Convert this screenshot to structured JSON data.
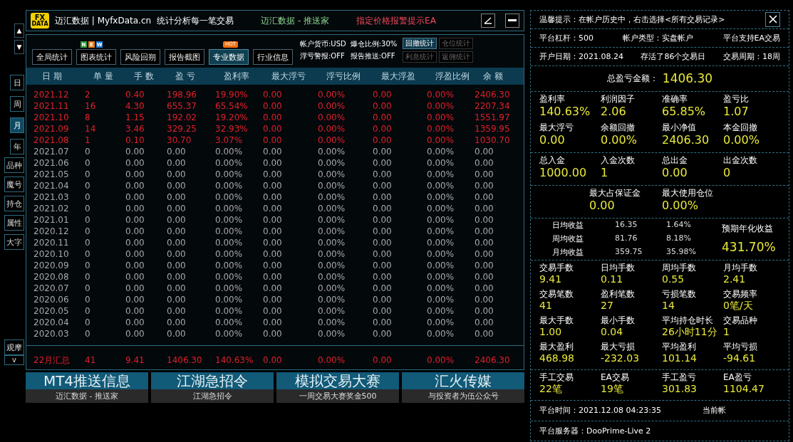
{
  "side_nav": {
    "scroll_up": "▲",
    "scroll_down": "▼",
    "periods": [
      {
        "label": "日",
        "selected": false
      },
      {
        "label": "周",
        "selected": false
      },
      {
        "label": "月",
        "selected": true
      },
      {
        "label": "年",
        "selected": false
      }
    ],
    "filters": [
      "品种",
      "魔号",
      "持仓",
      "属性",
      "大字"
    ],
    "watch": "观摩",
    "expand": "v"
  },
  "title_bar": {
    "logo_top": "FX",
    "logo_bottom": "DATA",
    "title": "迈汇数据 | MyfxData.cn",
    "slogan": "统计分析每一笔交易",
    "center": "迈汇数据 - 推送家",
    "alert": "指定价格报警提示EA"
  },
  "toolbar": {
    "tabs": [
      {
        "label": "全局统计",
        "selected": false
      },
      {
        "label": "图表统计",
        "selected": false,
        "badge_letters": [
          {
            "text": "N",
            "color": "#2e9a3a"
          },
          {
            "text": "E",
            "color": "#e87a10"
          },
          {
            "text": "W",
            "color": "#1e7ad8"
          }
        ]
      },
      {
        "label": "风险回朔",
        "selected": false
      },
      {
        "label": "报告截图",
        "selected": false
      },
      {
        "label": "专业数据",
        "selected": true,
        "badge_text": "HOT"
      },
      {
        "label": "行业信息",
        "selected": false
      }
    ],
    "info": [
      "帐户货币:USD",
      "爆仓比例:30%",
      "浮亏警报:OFF",
      "报告推送:OFF"
    ],
    "mini_buttons": [
      {
        "label": "回撤统计",
        "disabled": false
      },
      {
        "label": "仓位统计",
        "disabled": true
      },
      {
        "label": "利息统计",
        "disabled": true
      },
      {
        "label": "返佣统计",
        "disabled": true
      }
    ]
  },
  "table": {
    "columns": [
      "日 期",
      "单 量",
      "手 数",
      "盈 亏",
      "盈利率",
      "最大浮亏",
      "浮亏比例",
      "最大浮盈",
      "浮盈比例",
      "余 额"
    ],
    "rows": [
      {
        "has_trades": true,
        "cells": [
          "2021.12",
          "2",
          "0.40",
          "198.96",
          "19.90%",
          "0.00",
          "0.00%",
          "0.00",
          "0.00%",
          "2406.30"
        ]
      },
      {
        "has_trades": true,
        "cells": [
          "2021.11",
          "16",
          "4.30",
          "655.37",
          "65.54%",
          "0.00",
          "0.00%",
          "0.00",
          "0.00%",
          "2207.34"
        ]
      },
      {
        "has_trades": true,
        "cells": [
          "2021.10",
          "8",
          "1.15",
          "192.02",
          "19.20%",
          "0.00",
          "0.00%",
          "0.00",
          "0.00%",
          "1551.97"
        ]
      },
      {
        "has_trades": true,
        "cells": [
          "2021.09",
          "14",
          "3.46",
          "329.25",
          "32.93%",
          "0.00",
          "0.00%",
          "0.00",
          "0.00%",
          "1359.95"
        ]
      },
      {
        "has_trades": true,
        "cells": [
          "2021.08",
          "1",
          "0.10",
          "30.70",
          "3.07%",
          "0.00",
          "0.00%",
          "0.00",
          "0.00%",
          "1030.70"
        ]
      },
      {
        "has_trades": false,
        "cells": [
          "2021.07",
          "0",
          "0.00",
          "0.00",
          "0.00%",
          "0.00",
          "0.00%",
          "0.00",
          "0.00%",
          "0.00"
        ]
      },
      {
        "has_trades": false,
        "cells": [
          "2021.06",
          "0",
          "0.00",
          "0.00",
          "0.00%",
          "0.00",
          "0.00%",
          "0.00",
          "0.00%",
          "0.00"
        ]
      },
      {
        "has_trades": false,
        "cells": [
          "2021.05",
          "0",
          "0.00",
          "0.00",
          "0.00%",
          "0.00",
          "0.00%",
          "0.00",
          "0.00%",
          "0.00"
        ]
      },
      {
        "has_trades": false,
        "cells": [
          "2021.04",
          "0",
          "0.00",
          "0.00",
          "0.00%",
          "0.00",
          "0.00%",
          "0.00",
          "0.00%",
          "0.00"
        ]
      },
      {
        "has_trades": false,
        "cells": [
          "2021.03",
          "0",
          "0.00",
          "0.00",
          "0.00%",
          "0.00",
          "0.00%",
          "0.00",
          "0.00%",
          "0.00"
        ]
      },
      {
        "has_trades": false,
        "cells": [
          "2021.02",
          "0",
          "0.00",
          "0.00",
          "0.00%",
          "0.00",
          "0.00%",
          "0.00",
          "0.00%",
          "0.00"
        ]
      },
      {
        "has_trades": false,
        "cells": [
          "2021.01",
          "0",
          "0.00",
          "0.00",
          "0.00%",
          "0.00",
          "0.00%",
          "0.00",
          "0.00%",
          "0.00"
        ]
      },
      {
        "has_trades": false,
        "cells": [
          "2020.12",
          "0",
          "0.00",
          "0.00",
          "0.00%",
          "0.00",
          "0.00%",
          "0.00",
          "0.00%",
          "0.00"
        ]
      },
      {
        "has_trades": false,
        "cells": [
          "2020.11",
          "0",
          "0.00",
          "0.00",
          "0.00%",
          "0.00",
          "0.00%",
          "0.00",
          "0.00%",
          "0.00"
        ]
      },
      {
        "has_trades": false,
        "cells": [
          "2020.10",
          "0",
          "0.00",
          "0.00",
          "0.00%",
          "0.00",
          "0.00%",
          "0.00",
          "0.00%",
          "0.00"
        ]
      },
      {
        "has_trades": false,
        "cells": [
          "2020.09",
          "0",
          "0.00",
          "0.00",
          "0.00%",
          "0.00",
          "0.00%",
          "0.00",
          "0.00%",
          "0.00"
        ]
      },
      {
        "has_trades": false,
        "cells": [
          "2020.08",
          "0",
          "0.00",
          "0.00",
          "0.00%",
          "0.00",
          "0.00%",
          "0.00",
          "0.00%",
          "0.00"
        ]
      },
      {
        "has_trades": false,
        "cells": [
          "2020.07",
          "0",
          "0.00",
          "0.00",
          "0.00%",
          "0.00",
          "0.00%",
          "0.00",
          "0.00%",
          "0.00"
        ]
      },
      {
        "has_trades": false,
        "cells": [
          "2020.06",
          "0",
          "0.00",
          "0.00",
          "0.00%",
          "0.00",
          "0.00%",
          "0.00",
          "0.00%",
          "0.00"
        ]
      },
      {
        "has_trades": false,
        "cells": [
          "2020.05",
          "0",
          "0.00",
          "0.00",
          "0.00%",
          "0.00",
          "0.00%",
          "0.00",
          "0.00%",
          "0.00"
        ]
      },
      {
        "has_trades": false,
        "cells": [
          "2020.04",
          "0",
          "0.00",
          "0.00",
          "0.00%",
          "0.00",
          "0.00%",
          "0.00",
          "0.00%",
          "0.00"
        ]
      },
      {
        "has_trades": false,
        "cells": [
          "2020.03",
          "0",
          "0.00",
          "0.00",
          "0.00%",
          "0.00",
          "0.00%",
          "0.00",
          "0.00%",
          "0.00"
        ]
      }
    ],
    "summary": [
      "22月汇总",
      "41",
      "9.41",
      "1406.30",
      "140.63%",
      "0.00",
      "0.00%",
      "0.00",
      "0.00%",
      "2406.30"
    ]
  },
  "banners": [
    {
      "title": "MT4推送信息",
      "subtitle": "迈汇数据 - 推送家"
    },
    {
      "title": "江湖急招令",
      "subtitle": "江湖急招令"
    },
    {
      "title": "模拟交易大赛",
      "subtitle": "一周交易大赛奖金500"
    },
    {
      "title": "汇火传媒",
      "subtitle": "与投资者为伍公众号"
    }
  ],
  "right_panel": {
    "tip": "温馨提示：在帐户历史中，右击选择<所有交易记录>",
    "info_rows": [
      [
        "平台杠杆：500",
        "帐户类型：实盘帐户",
        "平台支持EA交易"
      ],
      [
        "开户日期：2021.08.24",
        "存活了86个交易日",
        "交易周期：18周"
      ]
    ],
    "total": {
      "label": "总盈亏金额：",
      "value": "1406.30"
    },
    "stat_groups": [
      {
        "kind": "grid",
        "items": [
          {
            "label": "盈利率",
            "value": "140.63%"
          },
          {
            "label": "利润因子",
            "value": "2.06"
          },
          {
            "label": "准确率",
            "value": "65.85%"
          },
          {
            "label": "盈亏比",
            "value": "1.07"
          },
          {
            "label": "最大浮亏",
            "value": "0.00"
          },
          {
            "label": "余额回撤",
            "value": "0.00%"
          },
          {
            "label": "最小净值",
            "value": "2406.30"
          },
          {
            "label": "本金回撤",
            "value": "0.00%"
          }
        ]
      },
      {
        "kind": "grid",
        "items": [
          {
            "label": "总入金",
            "value": "1000.00"
          },
          {
            "label": "入金次数",
            "value": "1"
          },
          {
            "label": "总出金",
            "value": "0.00"
          },
          {
            "label": "出金次数",
            "value": "0"
          }
        ]
      },
      {
        "kind": "centered",
        "items": [
          {
            "label": "最大占保证金",
            "value": "0.00"
          },
          {
            "label": "最大使用仓位",
            "value": "0.00%"
          }
        ]
      }
    ],
    "averages": {
      "rows": [
        {
          "label": "日均收益",
          "amount": "16.35",
          "percent": "1.64%"
        },
        {
          "label": "周均收益",
          "amount": "81.76",
          "percent": "8.18%"
        },
        {
          "label": "月均收益",
          "amount": "359.75",
          "percent": "35.98%"
        }
      ],
      "annual_label": "预期年化收益",
      "annual_value": "431.70%"
    },
    "stat_groups_2": [
      {
        "items": [
          {
            "label": "交易手数",
            "value": "9.41"
          },
          {
            "label": "日均手数",
            "value": "0.11"
          },
          {
            "label": "周均手数",
            "value": "0.55"
          },
          {
            "label": "月均手数",
            "value": "2.41"
          },
          {
            "label": "交易笔数",
            "value": "41"
          },
          {
            "label": "盈利笔数",
            "value": "27"
          },
          {
            "label": "亏损笔数",
            "value": "14"
          },
          {
            "label": "交易频率",
            "value": "0笔/天"
          },
          {
            "label": "最大手数",
            "value": "1.00"
          },
          {
            "label": "最小手数",
            "value": "0.04"
          },
          {
            "label": "平均持仓时长",
            "value": "26小时11分"
          },
          {
            "label": "交易品种",
            "value": "1"
          },
          {
            "label": "最大盈利",
            "value": "468.98"
          },
          {
            "label": "最大亏损",
            "value": "-232.03"
          },
          {
            "label": "平均盈利",
            "value": "101.14"
          },
          {
            "label": "平均亏损",
            "value": "-94.61"
          }
        ]
      },
      {
        "items": [
          {
            "label": "手工交易",
            "value": "22笔"
          },
          {
            "label": "EA交易",
            "value": "19笔"
          },
          {
            "label": "手工盈亏",
            "value": "301.83"
          },
          {
            "label": "EA盈亏",
            "value": "1104.47"
          }
        ]
      }
    ],
    "platform_time": "平台时间：2021.12.08 04:23:35",
    "current_account": "当前帐",
    "server": "平台服务器：DooPrime-Live 2"
  }
}
